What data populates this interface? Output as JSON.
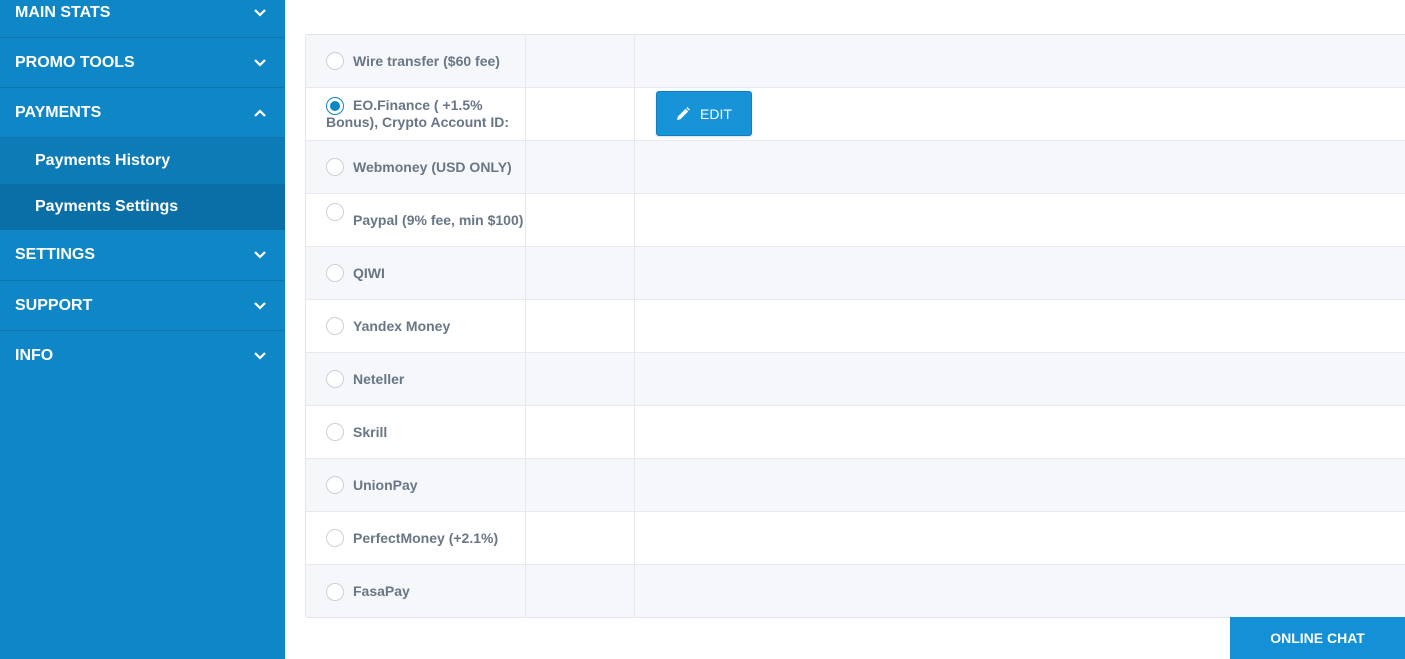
{
  "sidebar": {
    "items": [
      {
        "label": "MAIN STATS",
        "expanded": false
      },
      {
        "label": "PROMO TOOLS",
        "expanded": false
      },
      {
        "label": "PAYMENTS",
        "expanded": true
      },
      {
        "label": "SETTINGS",
        "expanded": false
      },
      {
        "label": "SUPPORT",
        "expanded": false
      },
      {
        "label": "INFO",
        "expanded": false
      }
    ],
    "payments_sub": [
      {
        "label": "Payments History"
      },
      {
        "label": "Payments Settings",
        "active": true
      }
    ]
  },
  "payment_methods": [
    {
      "label": "Wire transfer ($60 fee)",
      "selected": false
    },
    {
      "label": "EO.Finance ( +1.5% Bonus), Crypto Account ID:",
      "selected": true
    },
    {
      "label": "Webmoney (USD ONLY)",
      "selected": false
    },
    {
      "label": "Paypal (9% fee, min $100)",
      "selected": false
    },
    {
      "label": "QIWI",
      "selected": false
    },
    {
      "label": "Yandex Money",
      "selected": false
    },
    {
      "label": "Neteller",
      "selected": false
    },
    {
      "label": "Skrill",
      "selected": false
    },
    {
      "label": "UnionPay",
      "selected": false
    },
    {
      "label": "PerfectMoney (+2.1%)",
      "selected": false
    },
    {
      "label": "FasaPay",
      "selected": false
    }
  ],
  "edit_button": {
    "label": "EDIT"
  },
  "online_chat": {
    "label": "ONLINE CHAT"
  },
  "colors": {
    "sidebar": "#0f86c6",
    "accent": "#1793d8"
  }
}
